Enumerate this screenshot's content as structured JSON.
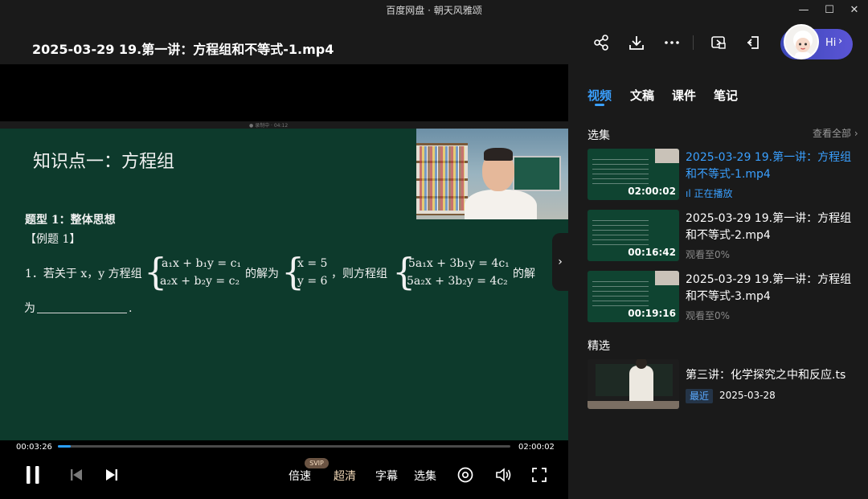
{
  "window": {
    "title": "百度网盘 · 朝天风雅颂",
    "minimize": "—",
    "maximize": "☐",
    "close": "✕"
  },
  "header": {
    "file_title": "2025-03-29 19.第一讲：方程组和不等式-1.mp4",
    "icons": [
      "share-icon",
      "download-icon",
      "more-icon",
      "screen-mirror-icon",
      "pin-icon"
    ],
    "assistant_label": "Hi",
    "assistant_arrow": "›"
  },
  "slide": {
    "heading": "知识点一：方程组",
    "type_label": "题型 1：整体思想",
    "example_label": "【例题 1】",
    "question_prefix": "1．若关于 x，y 方程组",
    "sys1_line1": "a₁x + b₁y = c₁",
    "sys1_line2": "a₂x + b₂y = c₂",
    "solution_text": "的解为",
    "sol_line1": "x = 5",
    "sol_line2": "y = 6",
    "then_text": "，则方程组",
    "sys2_line1": "5a₁x + 3b₁y = 4c₁",
    "sys2_line2": "5a₂x + 3b₂y = 4c₂",
    "end_text": "的解",
    "blank_prefix": "为",
    "blank_suffix": ".",
    "next_arrow": "›"
  },
  "player": {
    "current_time": "00:03:26",
    "total_time": "02:00:02",
    "progress": 0.0286,
    "speed_label": "倍速",
    "svip_badge": "SVIP",
    "quality_label": "超清",
    "subtitle_label": "字幕",
    "episodes_label": "选集",
    "colors": {
      "progress": "#2aa0ff",
      "quality": "#f0d7b6"
    }
  },
  "panel": {
    "tabs": [
      {
        "label": "视频",
        "active": true
      },
      {
        "label": "文稿",
        "active": false
      },
      {
        "label": "课件",
        "active": false
      },
      {
        "label": "笔记",
        "active": false
      }
    ],
    "episodes_section": "选集",
    "view_all": "查看全部 ›",
    "episodes": [
      {
        "title": "2025-03-29 19.第一讲：方程组和不等式-1.mp4",
        "duration": "02:00:02",
        "status": "正在播放",
        "playing": true
      },
      {
        "title": "2025-03-29 19.第一讲：方程组和不等式-2.mp4",
        "duration": "00:16:42",
        "status": "观看至0%",
        "playing": false
      },
      {
        "title": "2025-03-29 19.第一讲：方程组和不等式-3.mp4",
        "duration": "00:19:16",
        "status": "观看至0%",
        "playing": false
      }
    ],
    "featured_section": "精选",
    "featured": {
      "title": "第三讲：化学探究之中和反应.ts",
      "tag": "最近",
      "date": "2025-03-28"
    },
    "accent": "#3aa0ff"
  }
}
